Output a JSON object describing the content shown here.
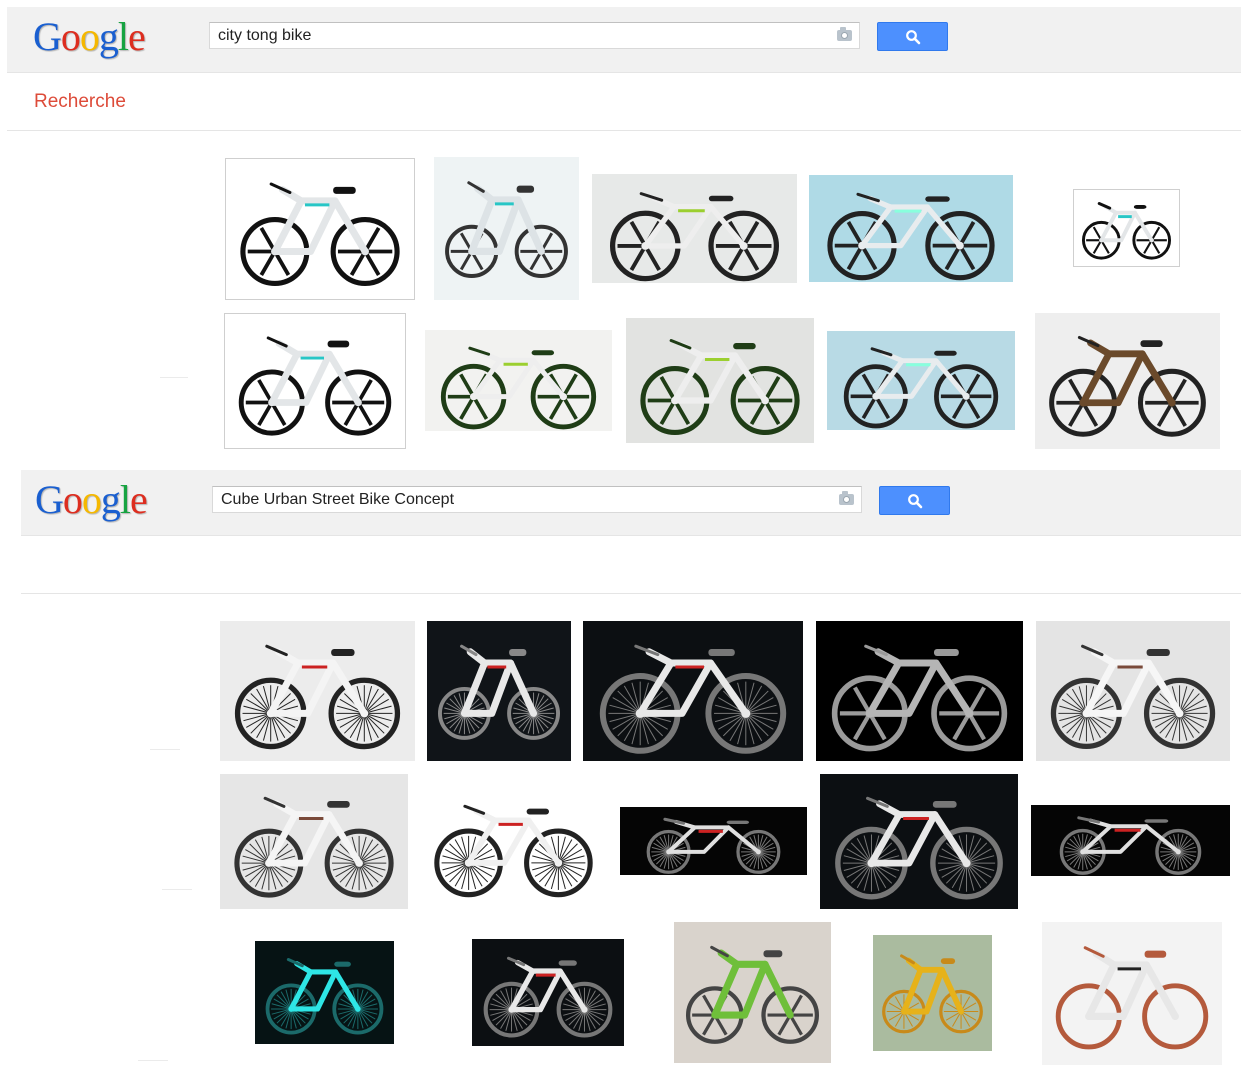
{
  "first_search": {
    "logo_letters": [
      "G",
      "o",
      "o",
      "g",
      "l",
      "e"
    ],
    "query": "city tong bike",
    "section_label": "Recherche"
  },
  "second_search": {
    "logo_letters": [
      "G",
      "o",
      "o",
      "g",
      "l",
      "e"
    ],
    "query": "Cube Urban Street Bike Concept"
  },
  "colors": {
    "logo": [
      "#1a5fd0",
      "#dd2d1f",
      "#f5b800",
      "#1a5fd0",
      "#16a341",
      "#dd2d1f"
    ],
    "search_button": "#4d90fe",
    "section_label": "#dd4b39"
  },
  "icons": {
    "search_button": "magnifier-icon",
    "search_box": "camera-icon"
  },
  "first_results_count": 10,
  "second_results_count": 15
}
